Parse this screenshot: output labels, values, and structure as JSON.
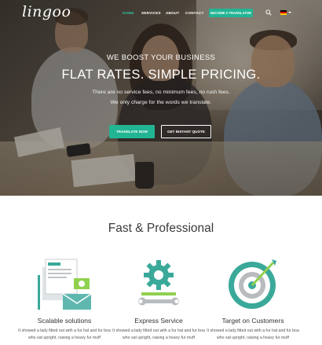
{
  "brand": {
    "logo": "lingoo"
  },
  "nav": {
    "items": [
      {
        "label": "HOME",
        "active": true
      },
      {
        "label": "SERVICES",
        "active": false
      },
      {
        "label": "ABOUT",
        "active": false
      },
      {
        "label": "CONTACT",
        "active": false
      }
    ],
    "cta_label": "BECOME A TRANSLATOR",
    "search_icon": "search-icon",
    "language_icon": "german-flag-icon"
  },
  "hero": {
    "kicker": "WE BOOST YOUR BUSINESS",
    "title": "FLAT RATES. SIMPLE PRICING.",
    "line1": "There are no service fees, no minimum fees, no rush fees.",
    "line2": "We only charge for the words we translate.",
    "primary_button": "TRANSLATE NOW",
    "secondary_button": "GET INSTANT QUOTE"
  },
  "features": {
    "title": "Fast & Professional",
    "items": [
      {
        "icon": "documents-icon",
        "title": "Scalable solutions",
        "text": "It showed a lady fitted out with a fur hat and fur boa who sat upright, raising a heavy fur muff"
      },
      {
        "icon": "gear-wrench-icon",
        "title": "Express Service",
        "text": "It showed a lady fitted out with a fur hat and fur boa who sat upright, raising a heavy fur muff"
      },
      {
        "icon": "target-icon",
        "title": "Target on Customers",
        "text": "It showed a lady fitted out with a fur hat and fur boa who sat upright, raising a heavy fur muff"
      }
    ]
  },
  "colors": {
    "accent": "#22b593",
    "accent_light": "#2ec4a0",
    "icon_teal": "#3aa99a",
    "icon_grey": "#b9bcbf",
    "heading": "#3a3a3a"
  }
}
